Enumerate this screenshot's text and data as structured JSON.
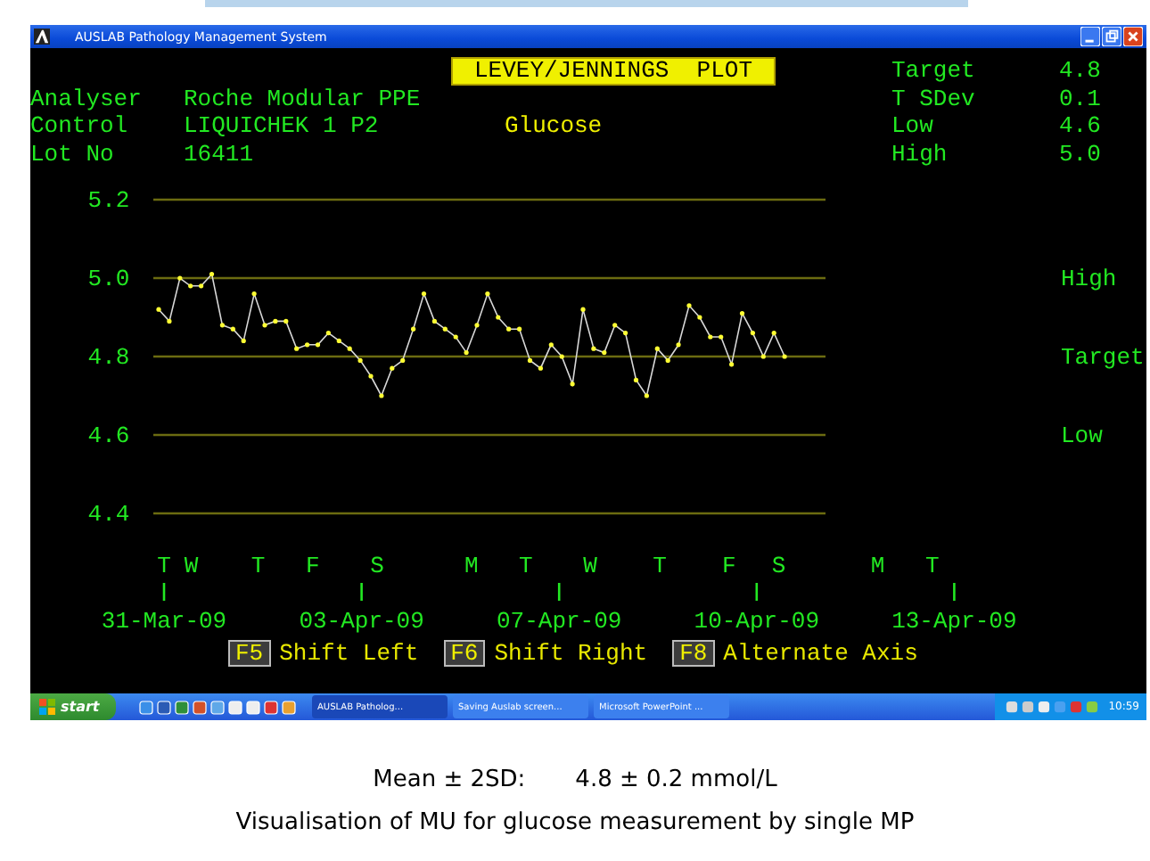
{
  "window": {
    "title": "AUSLAB Pathology Management System"
  },
  "header": {
    "title": "LEVEY/JENNINGS  PLOT",
    "test": "Glucose",
    "fields": [
      {
        "label": "Analyser",
        "value": "Roche Modular PPE"
      },
      {
        "label": "Control",
        "value": "LIQUICHEK 1 P2"
      },
      {
        "label": "Lot No",
        "value": "16411"
      }
    ],
    "stats": [
      {
        "label": "Target",
        "value": "4.8"
      },
      {
        "label": "T SDev",
        "value": "0.1"
      },
      {
        "label": "Low",
        "value": "4.6"
      },
      {
        "label": "High",
        "value": "5.0"
      }
    ]
  },
  "chart": {
    "chart_data": {
      "type": "line",
      "grid": true,
      "ylim": [
        4.4,
        5.2
      ],
      "yticks": [
        {
          "value": 5.2,
          "label": "5.2"
        },
        {
          "value": 5.0,
          "label": "5.0"
        },
        {
          "value": 4.8,
          "label": "4.8"
        },
        {
          "value": 4.6,
          "label": "4.6"
        },
        {
          "value": 4.4,
          "label": "4.4"
        }
      ],
      "series": [
        {
          "color": "#d8d8d8",
          "values": [
            4.92,
            4.89,
            5.0,
            4.98,
            4.98,
            5.01,
            4.88,
            4.87,
            4.84,
            4.96,
            4.88,
            4.89,
            4.89,
            4.82,
            4.83,
            4.83,
            4.86,
            4.84,
            4.82,
            4.79,
            4.75,
            4.7,
            4.77,
            4.79,
            4.87,
            4.96,
            4.89,
            4.87,
            4.85,
            4.81,
            4.88,
            4.96,
            4.9,
            4.87,
            4.87,
            4.79,
            4.77,
            4.83,
            4.8,
            4.73,
            4.92,
            4.82,
            4.81,
            4.88,
            4.86,
            4.74,
            4.7,
            4.82,
            4.79,
            4.83,
            4.93,
            4.9,
            4.85,
            4.85,
            4.78,
            4.91,
            4.86,
            4.8,
            4.86,
            4.8
          ]
        }
      ]
    },
    "reference_lines": [
      {
        "label": "High"
      },
      {
        "label": "Target"
      },
      {
        "label": "Low"
      }
    ],
    "days": [
      "T",
      "W",
      "T",
      "F",
      "S",
      "M",
      "T",
      "W",
      "T",
      "F",
      "S",
      "M",
      "T"
    ],
    "dates": [
      "31-Mar-09",
      "03-Apr-09",
      "07-Apr-09",
      "10-Apr-09",
      "13-Apr-09"
    ]
  },
  "function_keys": [
    {
      "key": "F5",
      "label": "Shift Left"
    },
    {
      "key": "F6",
      "label": "Shift Right"
    },
    {
      "key": "F8",
      "label": "Alternate Axis"
    }
  ],
  "taskbar": {
    "start": "start",
    "tasks": [
      {
        "label": "AUSLAB Patholog...",
        "selected": true
      },
      {
        "label": "Saving Auslab screen...",
        "selected": false
      },
      {
        "label": "Microsoft PowerPoint ...",
        "selected": false
      }
    ],
    "clock": "10:59"
  },
  "caption": {
    "mean_label": "Mean ± 2SD:",
    "mean_value": "4.8 ± 0.2 mmol/L",
    "text": "Visualisation of MU for glucose measurement by single MP"
  }
}
